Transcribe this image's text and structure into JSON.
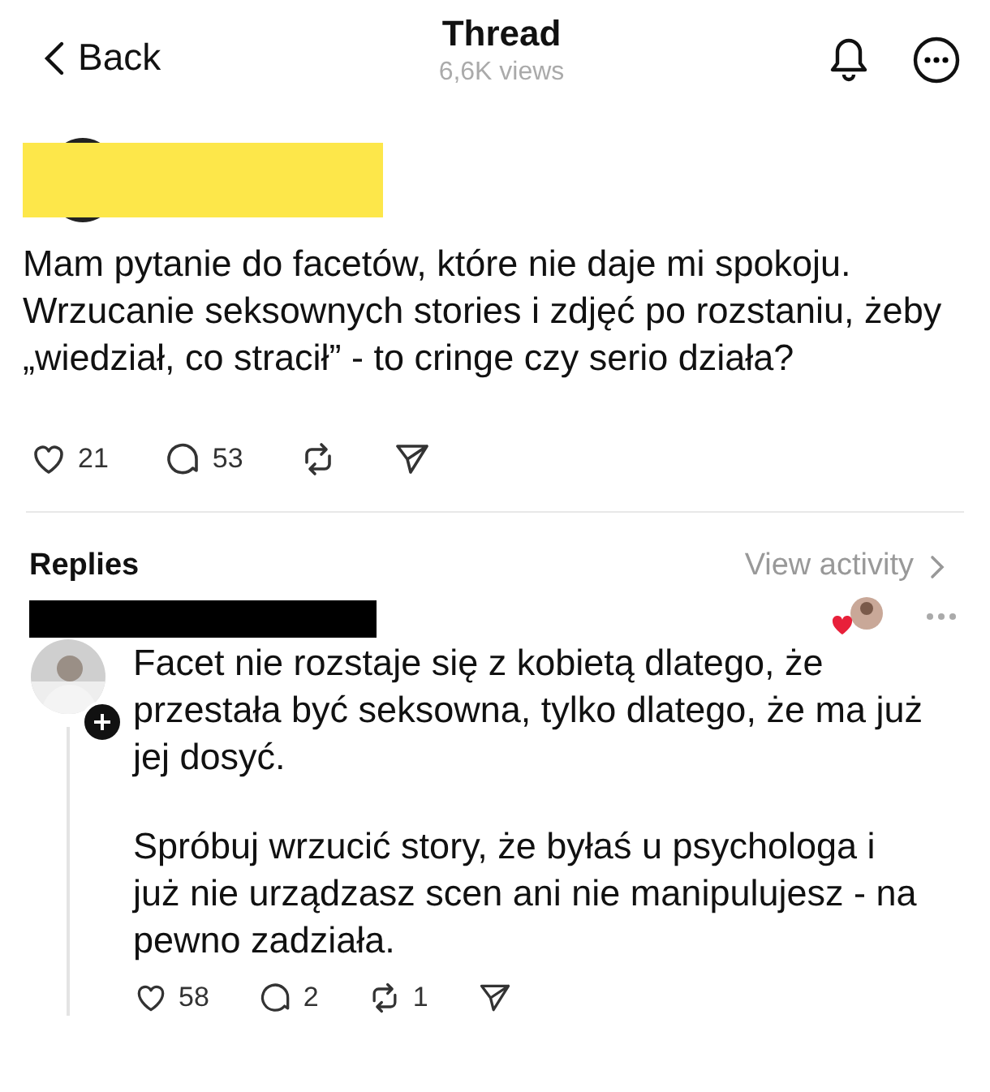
{
  "header": {
    "back": "Back",
    "title": "Thread",
    "views": "6,6K views"
  },
  "post": {
    "text": "Mam pytanie do facetów, które nie daje mi spokoju. Wrzucanie seksownych stories i zdjęć po rozstaniu, żeby „wiedział, co stracił” - to cringe czy serio działa?",
    "actions": [
      {
        "kind": "like",
        "count": "21"
      },
      {
        "kind": "reply",
        "count": "53"
      },
      {
        "kind": "repost"
      },
      {
        "kind": "share"
      }
    ]
  },
  "replies_bar": {
    "title": "Replies",
    "link": "View activity"
  },
  "reply": {
    "paragraphs": [
      "Facet nie rozstaje się z kobietą dlatego, że przestała być seksowna, tylko dlatego, że ma już jej dosyć.",
      "Spróbuj wrzucić story, że byłaś u psychologa i już nie urządzasz scen ani nie manipulujesz - na pewno zadziała."
    ],
    "liked_by_author": true,
    "actions": [
      {
        "kind": "like",
        "count": "58"
      },
      {
        "kind": "reply",
        "count": "2"
      },
      {
        "kind": "repost",
        "count": "1"
      },
      {
        "kind": "share"
      }
    ]
  }
}
